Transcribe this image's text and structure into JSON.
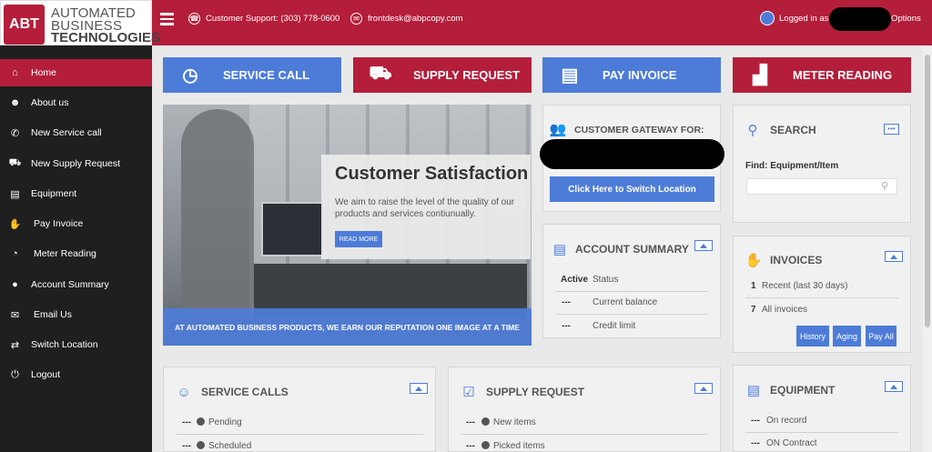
{
  "logo": {
    "mark": "ABT",
    "line1": "AUTOMATED",
    "line2": "BUSINESS",
    "line3": "TECHNOLOGIES"
  },
  "header": {
    "support": "Customer Support: (303) 778-0600",
    "email": "frontdesk@abpcopy.com",
    "logged_in": "Logged in as",
    "options": "Options"
  },
  "sidebar": {
    "items": [
      {
        "label": "Home",
        "icon": "home-icon"
      },
      {
        "label": "About us",
        "icon": "person-icon"
      },
      {
        "label": "New Service call",
        "icon": "phone-icon"
      },
      {
        "label": "New Supply Request",
        "icon": "truck-icon"
      },
      {
        "label": "Equipment",
        "icon": "printer-icon"
      },
      {
        "label": "Pay Invoice",
        "icon": "handshake-icon"
      },
      {
        "label": "Meter Reading",
        "icon": "gauge-icon"
      },
      {
        "label": "Account Summary",
        "icon": "account-icon"
      },
      {
        "label": "Email Us",
        "icon": "envelope-icon"
      },
      {
        "label": "Switch Location",
        "icon": "switch-location-icon"
      },
      {
        "label": "Logout",
        "icon": "logout-icon"
      }
    ]
  },
  "tiles": {
    "service_call": "SERVICE CALL",
    "supply_request": "SUPPLY REQUEST",
    "pay_invoice": "PAY INVOICE",
    "meter_reading": "METER READING"
  },
  "banner": {
    "title": "Customer Satisfaction",
    "text": "We aim to raise the level of the quality of our products and services contiunually.",
    "read_more": "READ MORE",
    "bar": "AT AUTOMATED BUSINESS PRODUCTS, WE EARN OUR REPUTATION ONE IMAGE AT A TIME"
  },
  "gateway": {
    "title": "CUSTOMER GATEWAY FOR:",
    "button": "Click Here to Switch Location"
  },
  "search": {
    "title": "SEARCH",
    "label": "Find: Equipment/Item"
  },
  "account_summary": {
    "title": "ACCOUNT SUMMARY",
    "rows": [
      {
        "value": "Active",
        "label": "Status"
      },
      {
        "value": "---",
        "label": "Current balance"
      },
      {
        "value": "---",
        "label": "Credit limit"
      }
    ]
  },
  "invoices": {
    "title": "INVOICES",
    "rows": [
      {
        "value": "1",
        "label": "Recent (last 30 days)"
      },
      {
        "value": "7",
        "label": "All invoices"
      }
    ],
    "buttons": {
      "history": "History",
      "aging": "Aging",
      "pay_all": "Pay All"
    }
  },
  "service_calls": {
    "title": "SERVICE CALLS",
    "rows": [
      {
        "value": "---",
        "label": "Pending"
      },
      {
        "value": "---",
        "label": "Scheduled"
      }
    ]
  },
  "supply_request": {
    "title": "SUPPLY REQUEST",
    "rows": [
      {
        "value": "---",
        "label": "New items"
      },
      {
        "value": "---",
        "label": "Picked items"
      }
    ]
  },
  "equipment": {
    "title": "EQUIPMENT",
    "rows": [
      {
        "value": "---",
        "label": "On record"
      },
      {
        "value": "---",
        "label": "ON Contract"
      }
    ]
  }
}
